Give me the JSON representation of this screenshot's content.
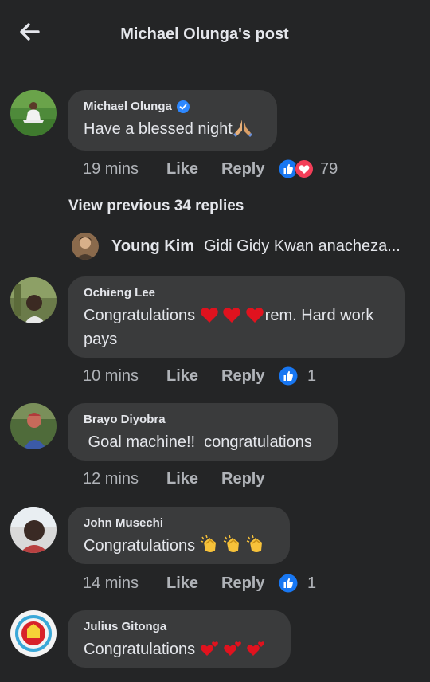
{
  "header": {
    "title": "Michael Olunga's post"
  },
  "comments": [
    {
      "author": "Michael Olunga",
      "verified": true,
      "text": "Have a blessed night",
      "time": "19 mins",
      "like": "Like",
      "reply": "Reply",
      "reactions": [
        "like",
        "love"
      ],
      "reaction_count": "79"
    },
    {
      "author": "Ochieng Lee",
      "text_before": "Congratulations ",
      "text_after": "rem. Hard work pays",
      "time": "10 mins",
      "like": "Like",
      "reply": "Reply",
      "reactions": [
        "like"
      ],
      "reaction_count": "1"
    },
    {
      "author": "Brayo Diyobra",
      "text": " Goal machine!!  congratulations",
      "time": "12 mins",
      "like": "Like",
      "reply": "Reply"
    },
    {
      "author": "John Musechi",
      "text": "Congratulations ",
      "time": "14 mins",
      "like": "Like",
      "reply": "Reply",
      "reactions": [
        "like"
      ],
      "reaction_count": "1"
    },
    {
      "author": "Julius Gitonga",
      "text": "Congratulations "
    }
  ],
  "view_previous": "View previous 34 replies",
  "reply_preview": {
    "author": "Young Kim",
    "text": "Gidi Gidy Kwan anacheza..."
  },
  "colors": {
    "background": "#242526",
    "bubble": "#3a3b3c",
    "like_blue": "#1877f2",
    "love_red": "#f33e58"
  }
}
